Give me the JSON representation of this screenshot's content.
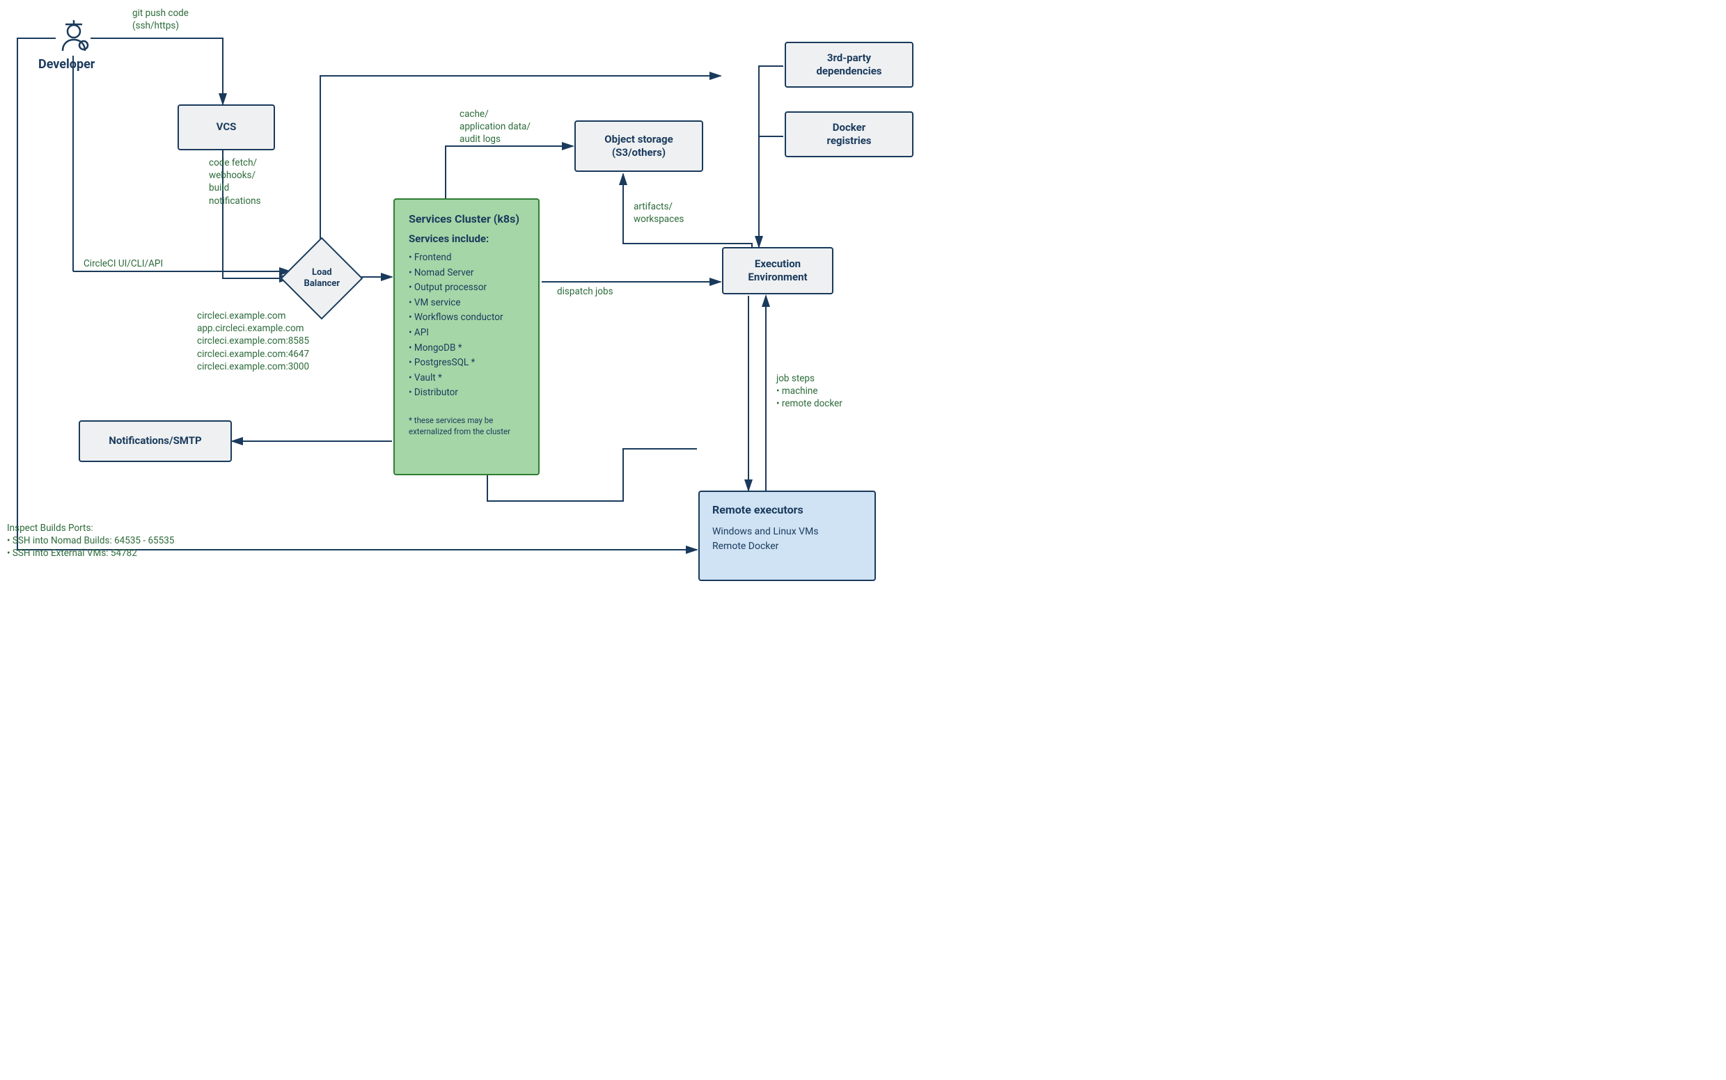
{
  "developer": {
    "label": "Developer"
  },
  "boxes": {
    "vcs": "VCS",
    "notifications": "Notifications/SMTP",
    "object_storage": "Object storage\n(S3/others)",
    "execution_env": "Execution\nEnvironment",
    "third_party": "3rd-party\ndependencies",
    "docker_reg": "Docker\nregistries"
  },
  "load_balancer": "Load\nBalancer",
  "services_cluster": {
    "title": "Services Cluster (k8s)",
    "subtitle": "Services include:",
    "items": [
      "Frontend",
      "Nomad Server",
      "Output processor",
      "VM service",
      "Workflows conductor",
      "API",
      "MongoDB *",
      "PostgresSQL *",
      "Vault *",
      "Distributor"
    ],
    "footnote": "* these services may be externalized from the cluster"
  },
  "remote_executors": {
    "title": "Remote executors",
    "body": "Windows and Linux VMs\nRemote Docker"
  },
  "edge_labels": {
    "git_push": "git push code\n(ssh/https)",
    "code_fetch": "code fetch/\nwebhooks/\nbuild\nnotifications",
    "circleci_ui": "CircleCI UI/CLI/API",
    "lb_domains": "circleci.example.com\napp.circleci.example.com\ncircleci.example.com:8585\ncircleci.example.com:4647\ncircleci.example.com:3000",
    "cache_app": "cache/\napplication data/\naudit logs",
    "artifacts": "artifacts/\nworkspaces",
    "dispatch": "dispatch jobs",
    "job_steps": "job steps\n• machine\n• remote docker",
    "inspect_ports": "Inspect Builds Ports:\n• SSH into Nomad Builds: 64535 - 65535\n• SSH into External VMs: 54782"
  }
}
